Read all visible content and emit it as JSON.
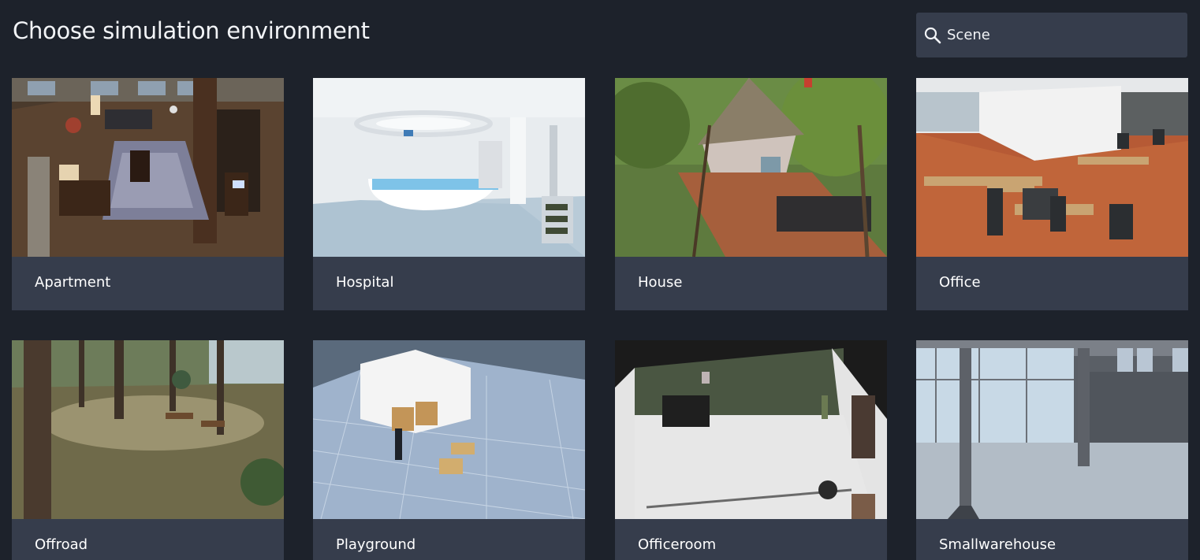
{
  "header": {
    "title": "Choose simulation environment",
    "search_placeholder": "Scene",
    "search_value": ""
  },
  "environments": [
    {
      "name": "Apartment",
      "icon": "apartment-preview"
    },
    {
      "name": "Hospital",
      "icon": "hospital-preview"
    },
    {
      "name": "House",
      "icon": "house-preview"
    },
    {
      "name": "Office",
      "icon": "office-preview"
    },
    {
      "name": "Offroad",
      "icon": "offroad-preview"
    },
    {
      "name": "Playground",
      "icon": "playground-preview"
    },
    {
      "name": "Officeroom",
      "icon": "officeroom-preview"
    },
    {
      "name": "Smallwarehouse",
      "icon": "smallwarehouse-preview"
    }
  ],
  "colors": {
    "background": "#1d222b",
    "card": "#363d4c",
    "text": "#ffffff"
  }
}
